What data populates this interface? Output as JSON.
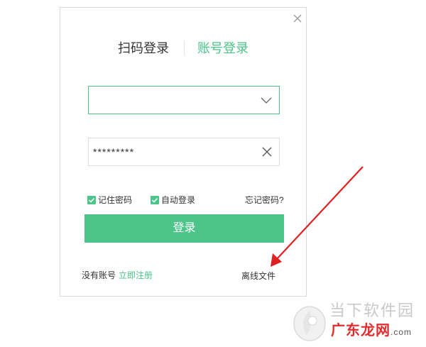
{
  "dialog": {
    "tabs": [
      {
        "label": "扫码登录",
        "active": false
      },
      {
        "label": "账号登录",
        "active": true
      }
    ],
    "username": {
      "value": "",
      "placeholder": ""
    },
    "password": {
      "value": "*********"
    },
    "remember_password": {
      "label": "记住密码",
      "checked": true
    },
    "auto_login": {
      "label": "自动登录",
      "checked": true
    },
    "forgot_password": "忘记密码?",
    "login_button": "登录",
    "no_account_text": "没有账号",
    "register_link": "立即注册",
    "offline_files": "离线文件"
  },
  "watermark": {
    "line1": "当下软件园",
    "line2": "广东龙网",
    "domain_suffix": ".com"
  },
  "colors": {
    "accent": "#4cc48a",
    "annotation_arrow": "#e02020"
  }
}
